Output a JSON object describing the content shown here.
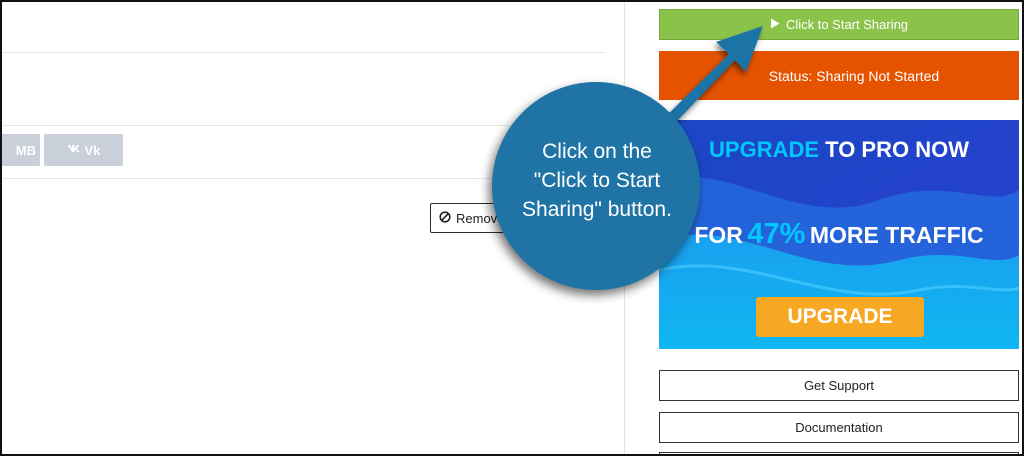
{
  "share_networks": [
    {
      "label": "MB",
      "icon": ""
    },
    {
      "label": "Vk",
      "icon": "vk-icon"
    }
  ],
  "remove_button": {
    "label": "Remove",
    "icon": "ban-icon"
  },
  "sidebar": {
    "start_button": {
      "label": "Click to Start Sharing",
      "icon": "play-icon"
    },
    "status": "Status: Sharing Not Started",
    "ad": {
      "headline_1": "UPGRADE",
      "headline_2": "TO PRO NOW",
      "line_2_a": "FOR",
      "line_2_b": "47%",
      "line_2_c": "MORE TRAFFIC",
      "button": "UPGRADE",
      "colors": {
        "highlight": "#00c8ff",
        "button": "#f7a823",
        "background": "#1d49c8"
      }
    },
    "buttons": [
      "Get Support",
      "Documentation"
    ]
  },
  "callout": {
    "text_lines": [
      "Click on the",
      "\"Click to Start",
      "Sharing\" button."
    ],
    "color": "#1f73a5"
  }
}
